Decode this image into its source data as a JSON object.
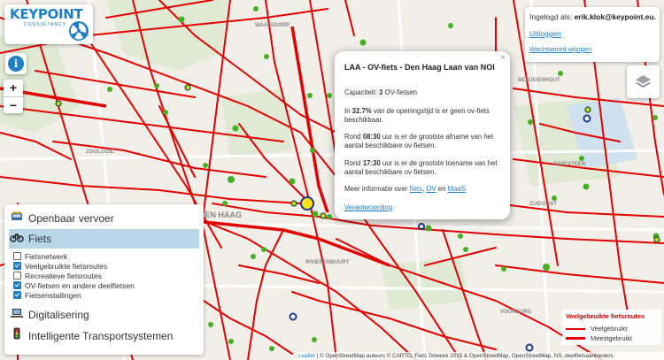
{
  "brand": {
    "logo_text": "KEYPOINT",
    "logo_sub": "CONSULTANCY"
  },
  "controls": {
    "info_icon": "i",
    "zoom_in": "+",
    "zoom_out": "−"
  },
  "login": {
    "label": "Ingelogd als:",
    "user": "erik.klok@keypoint.eu.",
    "logout": "Uitloggen",
    "change_password": "Wachtwoord wijzigen"
  },
  "popup": {
    "close": "×",
    "title": "LAA - OV-fiets - Den Haag Laan van NOI",
    "capacity_prefix": "Capaciteit: ",
    "capacity_value": "3",
    "capacity_suffix": " OV-fietsen",
    "empty_prefix": "In ",
    "empty_pct": "32.7%",
    "empty_suffix": " van de openingstijd is er geen ov-fiets beschikbaar.",
    "decline_prefix": "Rond ",
    "decline_time": "08:30",
    "decline_suffix": " uur is er de grootste afname van het aantal beschikbare ov-fietsen.",
    "rise_prefix": "Rond ",
    "rise_time": "17:30",
    "rise_suffix": " uur is er de grootste toename van het aantal beschikbare ov-fietsen.",
    "more_prefix": "Meer informatie over ",
    "link_fiets": "fiets",
    "sep1": ", ",
    "link_ov": "OV",
    "sep2": " en ",
    "link_maas": "MaaS",
    "accountability": "Verantwoording"
  },
  "panel": {
    "sections": [
      {
        "label": "Openbaar vervoer",
        "icon": "bus-icon"
      },
      {
        "label": "Fiets",
        "icon": "bike-icon"
      },
      {
        "label": "Digitalisering",
        "icon": "laptop-icon"
      },
      {
        "label": "Intelligente Transportsystemen",
        "icon": "traffic-light-icon"
      }
    ],
    "fiets_items": [
      {
        "label": "Fietsnetwerk",
        "checked": false
      },
      {
        "label": "Veelgebruikte fietsroutes",
        "checked": true
      },
      {
        "label": "Recreatieve fietsroutes",
        "checked": false
      },
      {
        "label": "OV-fietsen en andere deelfietsen",
        "checked": true
      },
      {
        "label": "Fietsenstallingen",
        "checked": true
      }
    ]
  },
  "map_legend": {
    "title": "Veelgebruikte fietsroutes",
    "items": [
      "Veelgebruikt",
      "Meestgebruikt"
    ],
    "color": "#e30000"
  },
  "map_labels": [
    "WAALSDORP",
    "BEZUIDENHOUT",
    "RIVIERENBUURT",
    "ESSESTEEN",
    "VOORBURG",
    "DEN HAAG",
    "ZOOLOGIE",
    "ZUIDOOST"
  ],
  "attribution": {
    "leaflet": "Leaflet",
    "text": " | © OpenStreetMap-auteurs © CARTO, Fiets Telweek 2015 & OpenStreetMap, OpenStreetMap, NS, deelfietsaanbieders"
  }
}
